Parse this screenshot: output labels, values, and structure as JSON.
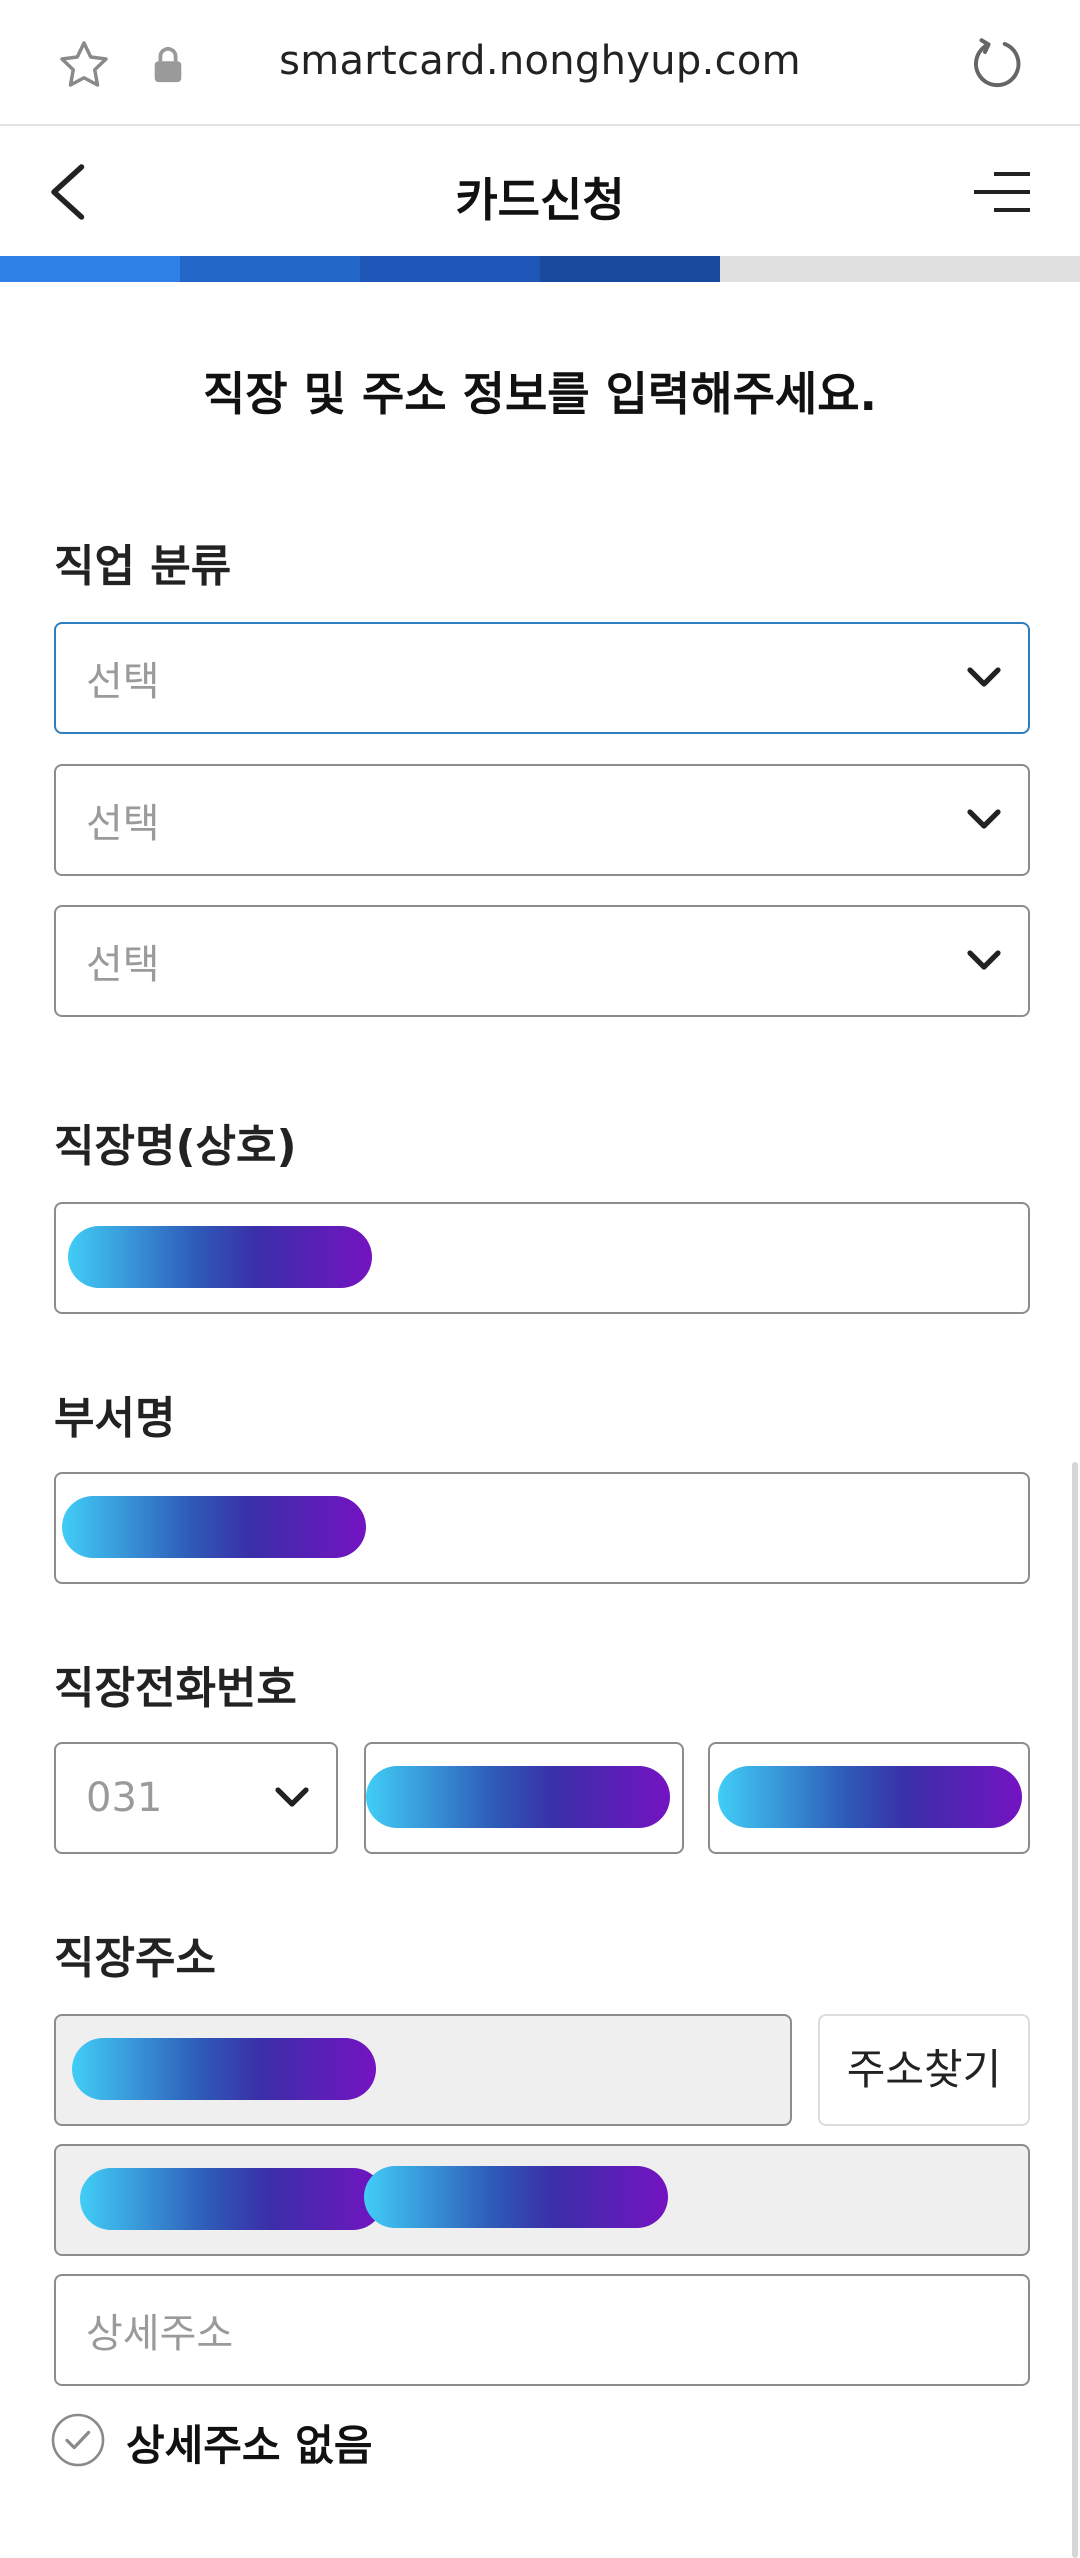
{
  "browser": {
    "url": "smartcard.nonghyup.com"
  },
  "header": {
    "title": "카드신청"
  },
  "progress": {
    "steps_total": 4,
    "steps_done": 4,
    "colors": [
      "#2f80e6",
      "#2266c8",
      "#1e57b8",
      "#1a4a9e"
    ]
  },
  "form": {
    "heading": "직장 및 주소 정보를 입력해주세요.",
    "job_category": {
      "label": "직업 분류",
      "selects": [
        {
          "placeholder": "선택"
        },
        {
          "placeholder": "선택"
        },
        {
          "placeholder": "선택"
        }
      ]
    },
    "company_name": {
      "label": "직장명(상호)"
    },
    "department": {
      "label": "부서명"
    },
    "work_phone": {
      "label": "직장전화번호",
      "area_code": "031"
    },
    "work_address": {
      "label": "직장주소",
      "search_button": "주소찾기",
      "detail_placeholder": "상세주소",
      "no_detail_label": "상세주소 없음"
    }
  },
  "icons": {
    "favorite": "star-icon",
    "secure": "lock-icon",
    "reload": "reload-icon",
    "back": "chevron-left-icon",
    "menu": "menu-icon",
    "dropdown": "chevron-down-icon",
    "checkbox": "check-circle-icon"
  }
}
